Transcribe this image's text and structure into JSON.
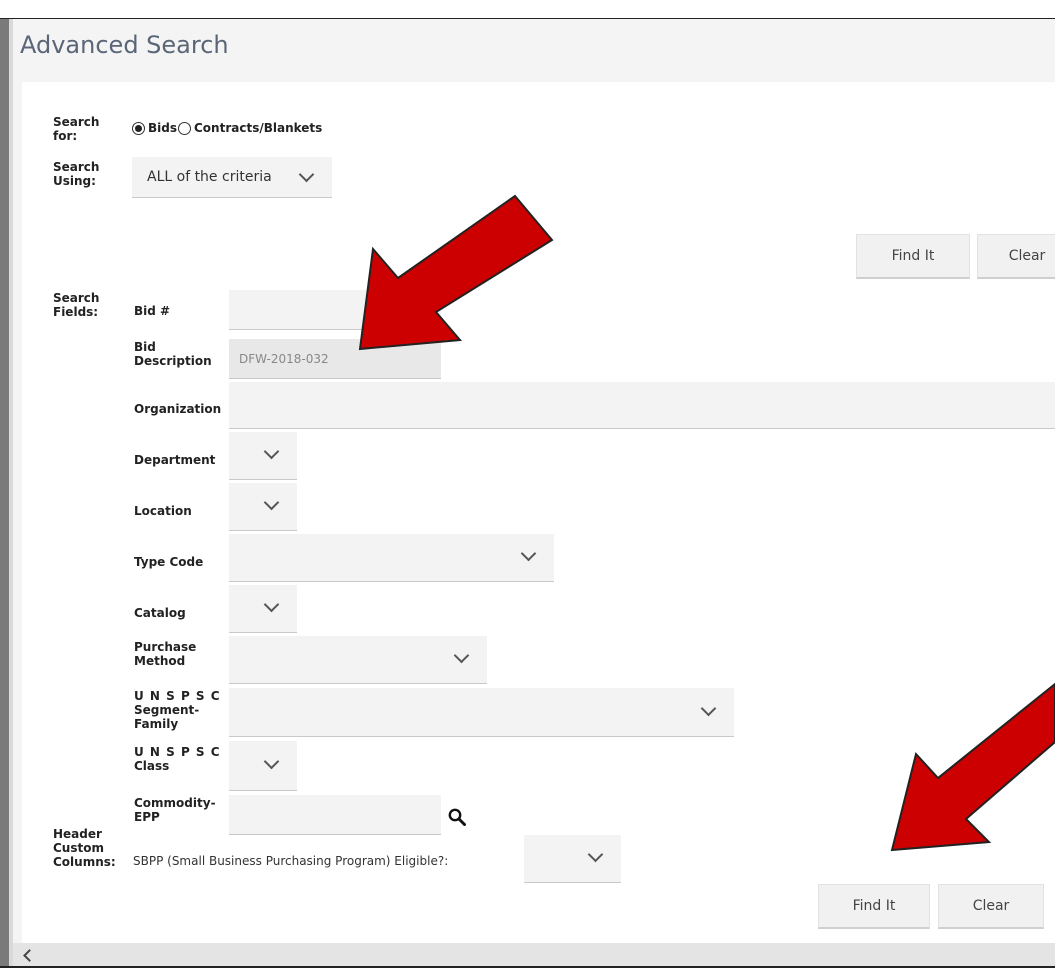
{
  "page_title": "Advanced Search",
  "search_for": {
    "label": "Search for:",
    "options": [
      {
        "label": "Bids",
        "selected": true
      },
      {
        "label": "Contracts/Blankets",
        "selected": false
      }
    ]
  },
  "search_using": {
    "label": "Search Using:",
    "value": "ALL of the criteria"
  },
  "buttons": {
    "find_it": "Find It",
    "clear": "Clear"
  },
  "search_fields": {
    "label": "Search Fields:",
    "bid_number": {
      "label": "Bid #",
      "value": ""
    },
    "bid_description": {
      "label": "Bid Description",
      "value": "DFW-2018-032"
    },
    "organization": {
      "label": "Organization",
      "value": ""
    },
    "department": {
      "label": "Department"
    },
    "location": {
      "label": "Location"
    },
    "type_code": {
      "label": "Type Code"
    },
    "catalog": {
      "label": "Catalog"
    },
    "purchase_method": {
      "label": "Purchase Method"
    },
    "unspsc_segment_family": {
      "label": "U N S P S C Segment-Family"
    },
    "unspsc_class": {
      "label": "U N S P S C Class"
    },
    "commodity_epp": {
      "label": "Commodity-EPP",
      "value": ""
    }
  },
  "header_custom_columns": {
    "label": "Header Custom Columns:",
    "sbpp_label": "SBPP (Small Business Purchasing Program) Eligible?:"
  },
  "colors": {
    "title": "#5a6678",
    "field_bg": "#f3f3f3",
    "arrow_red": "#cc0000",
    "button_bg": "#f1f1f1"
  },
  "icons": {
    "search": "magnifier-icon",
    "dropdown": "chevron-down-icon",
    "annotation": "red-arrow"
  }
}
